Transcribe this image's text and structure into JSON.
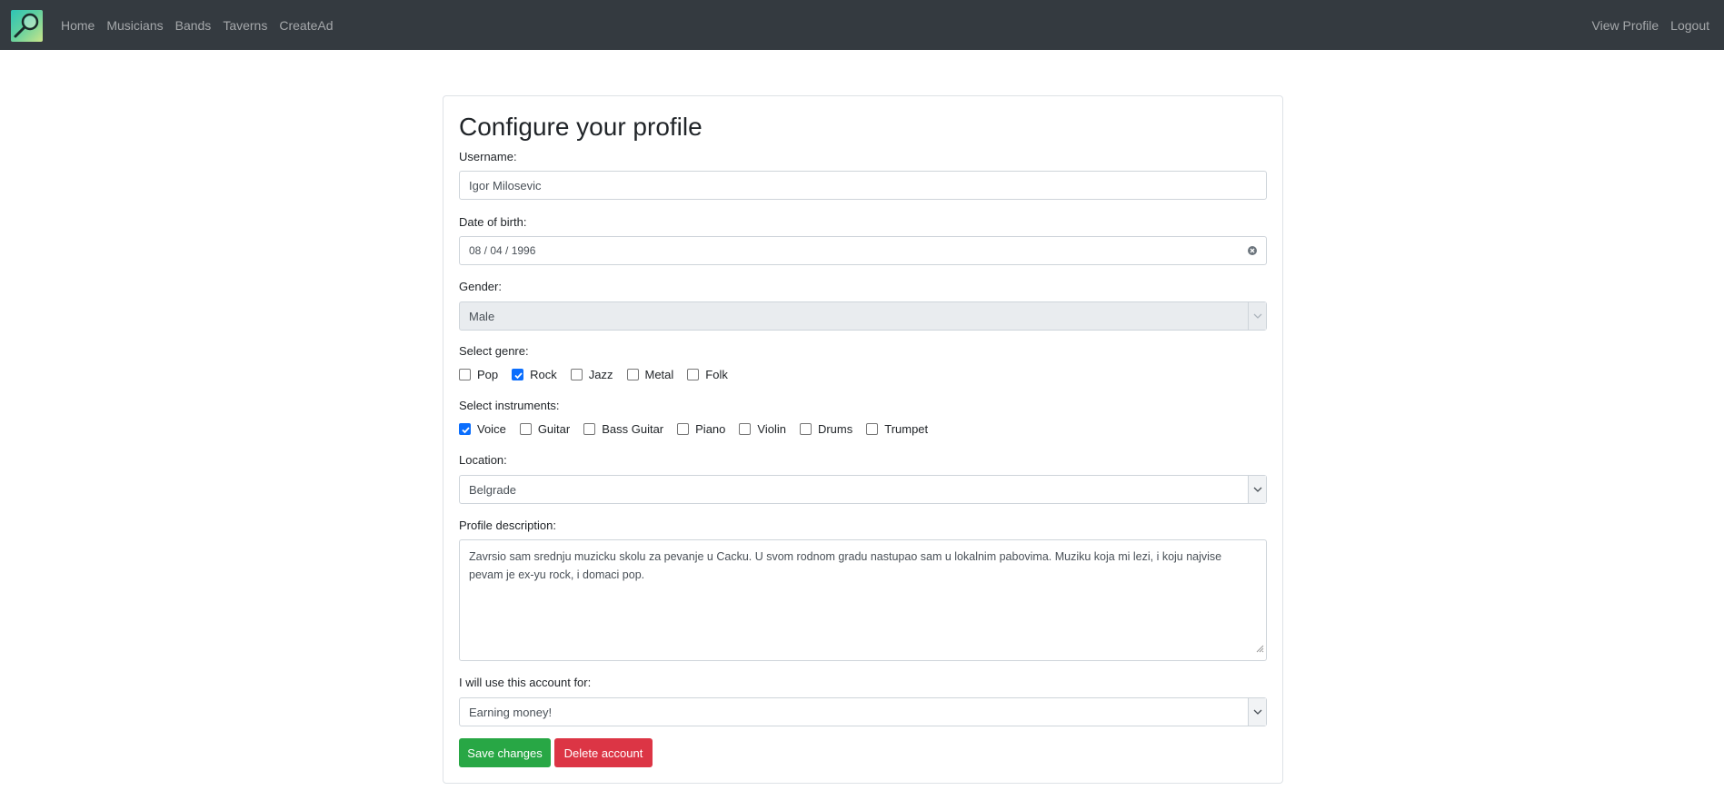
{
  "nav": {
    "left": [
      "Home",
      "Musicians",
      "Bands",
      "Taverns",
      "CreateAd"
    ],
    "right": [
      "View Profile",
      "Logout"
    ]
  },
  "form": {
    "title": "Configure your profile",
    "username_label": "Username:",
    "username_value": "Igor Milosevic",
    "dob_label": "Date of birth:",
    "dob_value": "08 / 04 / 1996",
    "gender_label": "Gender:",
    "gender_value": "Male",
    "genre_label": "Select genre:",
    "genres": [
      {
        "label": "Pop",
        "checked": false
      },
      {
        "label": "Rock",
        "checked": true
      },
      {
        "label": "Jazz",
        "checked": false
      },
      {
        "label": "Metal",
        "checked": false
      },
      {
        "label": "Folk",
        "checked": false
      }
    ],
    "instruments_label": "Select instruments:",
    "instruments": [
      {
        "label": "Voice",
        "checked": true
      },
      {
        "label": "Guitar",
        "checked": false
      },
      {
        "label": "Bass Guitar",
        "checked": false
      },
      {
        "label": "Piano",
        "checked": false
      },
      {
        "label": "Violin",
        "checked": false
      },
      {
        "label": "Drums",
        "checked": false
      },
      {
        "label": "Trumpet",
        "checked": false
      }
    ],
    "location_label": "Location:",
    "location_value": "Belgrade",
    "description_label": "Profile description:",
    "description_value": "Zavrsio sam srednju muzicku skolu za pevanje u Cacku. U svom rodnom gradu nastupao sam u lokalnim pabovima. Muziku koja mi lezi, i koju najvise pevam je ex-yu rock, i domaci pop.",
    "usage_label": "I will use this account for:",
    "usage_value": "Earning money!",
    "save_label": "Save changes",
    "delete_label": "Delete account"
  },
  "colors": {
    "navbar": "#343a40",
    "save": "#28a745",
    "delete": "#dc3545",
    "checkbox_checked": "#0b6efd"
  },
  "icons": {
    "logo": "magnifier-logo-icon",
    "dob_clear": "clear-circle-icon",
    "select": "chevron-down-icon"
  }
}
